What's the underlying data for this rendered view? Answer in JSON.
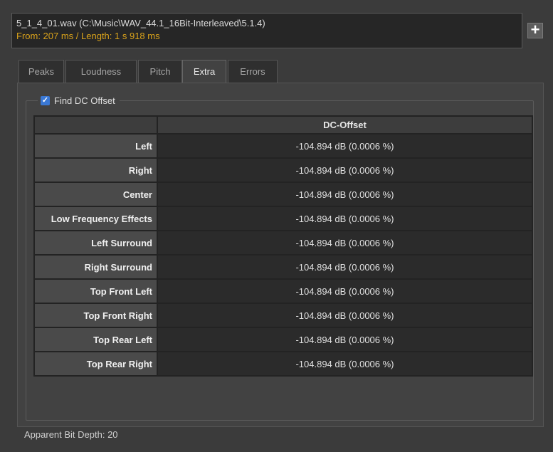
{
  "file": {
    "name": "5_1_4_01.wav (C:\\Music\\WAV_44.1_16Bit-Interleaved\\5.1.4)",
    "range": "From: 207 ms / Length: 1 s 918 ms",
    "add_label": "+"
  },
  "tabs": [
    {
      "label": "Peaks",
      "active": false
    },
    {
      "label": "Loudness",
      "active": false
    },
    {
      "label": "Pitch",
      "active": false
    },
    {
      "label": "Extra",
      "active": true
    },
    {
      "label": "Errors",
      "active": false
    }
  ],
  "dc_offset": {
    "checkbox_label": "Find DC Offset",
    "checked": true,
    "column_header": "DC-Offset",
    "rows": [
      {
        "channel": "Left",
        "value": "-104.894 dB (0.0006 %)"
      },
      {
        "channel": "Right",
        "value": "-104.894 dB (0.0006 %)"
      },
      {
        "channel": "Center",
        "value": "-104.894 dB (0.0006 %)"
      },
      {
        "channel": "Low Frequency Effects",
        "value": "-104.894 dB (0.0006 %)"
      },
      {
        "channel": "Left Surround",
        "value": "-104.894 dB (0.0006 %)"
      },
      {
        "channel": "Right Surround",
        "value": "-104.894 dB (0.0006 %)"
      },
      {
        "channel": "Top Front Left",
        "value": "-104.894 dB (0.0006 %)"
      },
      {
        "channel": "Top Front Right",
        "value": "-104.894 dB (0.0006 %)"
      },
      {
        "channel": "Top Rear Left",
        "value": "-104.894 dB (0.0006 %)"
      },
      {
        "channel": "Top Rear Right",
        "value": "-104.894 dB (0.0006 %)"
      }
    ]
  },
  "footer": {
    "bit_depth": "Apparent Bit Depth:  20"
  },
  "colors": {
    "range_text": "#d9a21b",
    "checkbox": "#3a78d4"
  }
}
